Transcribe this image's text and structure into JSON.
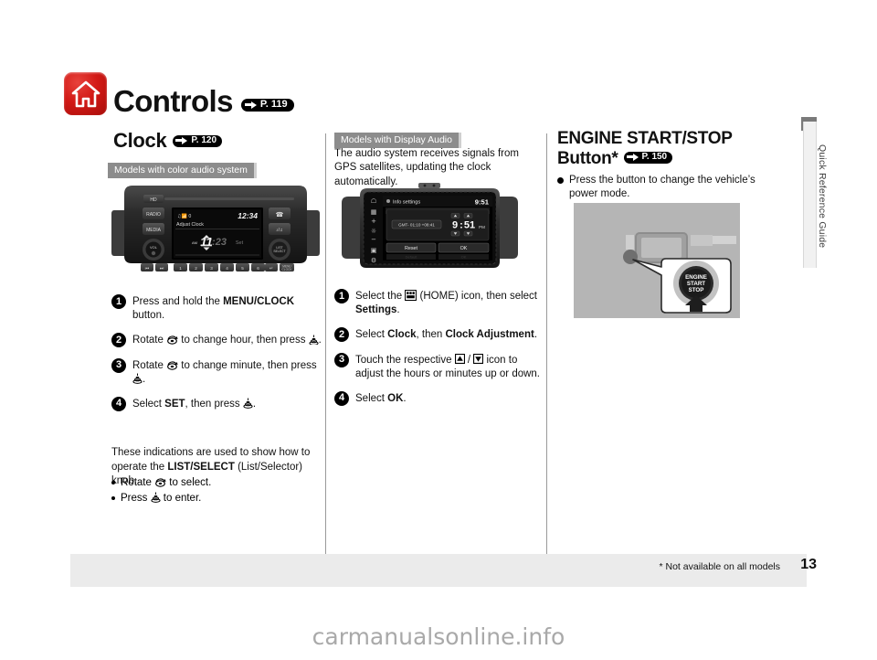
{
  "page": {
    "number": "13",
    "footnote": "* Not available on all models",
    "side_tab": "Quick Reference Guide",
    "watermark": "carmanualsonline.info"
  },
  "header": {
    "title": "Controls",
    "title_ref": "P. 119",
    "home_icon": "home-icon"
  },
  "left": {
    "section_title": "Clock",
    "section_ref": "P. 120",
    "model_banner": "Models with color audio system",
    "head_unit": {
      "btn_hd": "HD",
      "btn_radio": "RADIO",
      "btn_media": "MEDIA",
      "btn_phone": "phone-icon",
      "btn_talk": "talk-icon",
      "vol_label": "VOL",
      "sel_label": "LIST\\nSELECT",
      "back_label": "back-icon",
      "menu_label": "MENU\\nCLOCK",
      "presets": [
        "1",
        "2",
        "3",
        "4",
        "5",
        "6"
      ],
      "screen": {
        "status_icons": "bluetooth-signal-icons",
        "status_count": "0",
        "clock": "12:34",
        "mode_title": "Adjust Clock",
        "ampm": "AM",
        "hour": "11",
        "sep": ":",
        "minute": "23",
        "set_label": "Set"
      }
    },
    "steps": [
      {
        "num": "1",
        "parts": [
          {
            "t": "text",
            "v": "Press and hold the "
          },
          {
            "t": "b",
            "v": "MENU/CLOCK"
          },
          {
            "t": "text",
            "v": " button."
          }
        ]
      },
      {
        "num": "2",
        "parts": [
          {
            "t": "text",
            "v": "Rotate "
          },
          {
            "t": "icon",
            "v": "rotate-knob-icon"
          },
          {
            "t": "text",
            "v": " to change hour, then press "
          },
          {
            "t": "icon",
            "v": "press-knob-icon"
          },
          {
            "t": "text",
            "v": "."
          }
        ]
      },
      {
        "num": "3",
        "parts": [
          {
            "t": "text",
            "v": "Rotate "
          },
          {
            "t": "icon",
            "v": "rotate-knob-icon"
          },
          {
            "t": "text",
            "v": " to change minute, then press "
          },
          {
            "t": "icon",
            "v": "press-knob-icon"
          },
          {
            "t": "text",
            "v": "."
          }
        ]
      },
      {
        "num": "4",
        "parts": [
          {
            "t": "text",
            "v": "Select "
          },
          {
            "t": "b",
            "v": "SET"
          },
          {
            "t": "text",
            "v": ", then press "
          },
          {
            "t": "icon",
            "v": "press-knob-icon"
          },
          {
            "t": "text",
            "v": "."
          }
        ]
      }
    ],
    "tail_parts": [
      {
        "t": "text",
        "v": "These indications are used to show how to operate the "
      },
      {
        "t": "b",
        "v": "LIST/SELECT"
      },
      {
        "t": "text",
        "v": " (List/Selector) knob."
      }
    ],
    "bullets": [
      [
        {
          "t": "text",
          "v": "Rotate "
        },
        {
          "t": "icon",
          "v": "rotate-knob-icon"
        },
        {
          "t": "text",
          "v": " to select."
        }
      ],
      [
        {
          "t": "text",
          "v": "Press "
        },
        {
          "t": "icon",
          "v": "press-knob-icon"
        },
        {
          "t": "text",
          "v": " to enter."
        }
      ]
    ]
  },
  "middle": {
    "model_banner": "Models with Display Audio",
    "intro": "The audio system receives signals from GPS satellites, updating the clock automatically.",
    "display_audio": {
      "side_icons": [
        "home-icon",
        "apps-icon",
        "plus-icon",
        "brightness-icon",
        "minus-icon",
        "display-icon",
        "settings-icon"
      ],
      "status_title": "Info settings",
      "status_clock": "9:51",
      "gmt_label": "GMT- 01:10 +08:41",
      "hour": "9",
      "sep": ":",
      "minute": "51",
      "ampm": "PM",
      "btn_reset": "Reset",
      "btn_ok": "OK"
    },
    "steps": [
      {
        "num": "1",
        "parts": [
          {
            "t": "text",
            "v": "Select the "
          },
          {
            "t": "icon",
            "v": "home-grid-icon"
          },
          {
            "t": "text",
            "v": " (HOME) icon, then select "
          },
          {
            "t": "b",
            "v": "Settings"
          },
          {
            "t": "text",
            "v": "."
          }
        ]
      },
      {
        "num": "2",
        "parts": [
          {
            "t": "text",
            "v": "Select "
          },
          {
            "t": "b",
            "v": "Clock"
          },
          {
            "t": "text",
            "v": ", then "
          },
          {
            "t": "b",
            "v": "Clock Adjustment"
          },
          {
            "t": "text",
            "v": "."
          }
        ]
      },
      {
        "num": "3",
        "parts": [
          {
            "t": "text",
            "v": "Touch the respective "
          },
          {
            "t": "icon",
            "v": "arrow-up-icon"
          },
          {
            "t": "text",
            "v": " / "
          },
          {
            "t": "icon",
            "v": "arrow-down-icon"
          },
          {
            "t": "text",
            "v": " icon to adjust the hours or minutes up or down."
          }
        ]
      },
      {
        "num": "4",
        "parts": [
          {
            "t": "text",
            "v": "Select "
          },
          {
            "t": "b",
            "v": "OK"
          },
          {
            "t": "text",
            "v": "."
          }
        ]
      }
    ]
  },
  "right": {
    "title_line1": "ENGINE START/STOP",
    "title_line2": "Button*",
    "title_ref": "P. 150",
    "bullet": "Press the button to change the vehicle’s power mode.",
    "button_label_l1": "ENGINE",
    "button_label_l2": "START",
    "button_label_l3": "STOP"
  }
}
